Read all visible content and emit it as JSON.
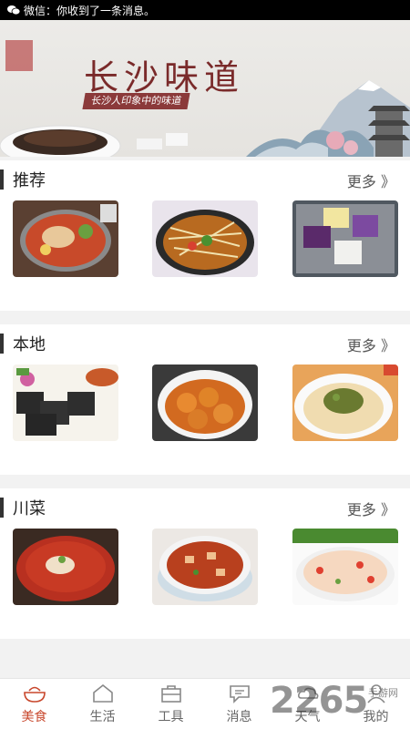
{
  "status_bar": {
    "notification": "微信：你收到了一条消息。",
    "icon": "wechat-icon"
  },
  "banner": {
    "title": "长沙味道",
    "subtitle": "长沙人印象中的味道"
  },
  "sections": [
    {
      "title": "推荐",
      "more": "更多 》"
    },
    {
      "title": "本地",
      "more": "更多 》"
    },
    {
      "title": "川菜",
      "more": "更多 》"
    }
  ],
  "tabs": [
    {
      "label": "美食",
      "icon": "food-bowl-icon",
      "active": true
    },
    {
      "label": "生活",
      "icon": "home-icon",
      "active": false
    },
    {
      "label": "工具",
      "icon": "toolbox-icon",
      "active": false
    },
    {
      "label": "消息",
      "icon": "message-icon",
      "active": false
    },
    {
      "label": "天气",
      "icon": "weather-icon",
      "active": false
    },
    {
      "label": "我的",
      "icon": "user-icon",
      "active": false
    }
  ],
  "watermark": {
    "text": "2265",
    "sub": "手游网"
  },
  "colors": {
    "accent": "#c8472c",
    "banner_title": "#7a2a2a"
  }
}
